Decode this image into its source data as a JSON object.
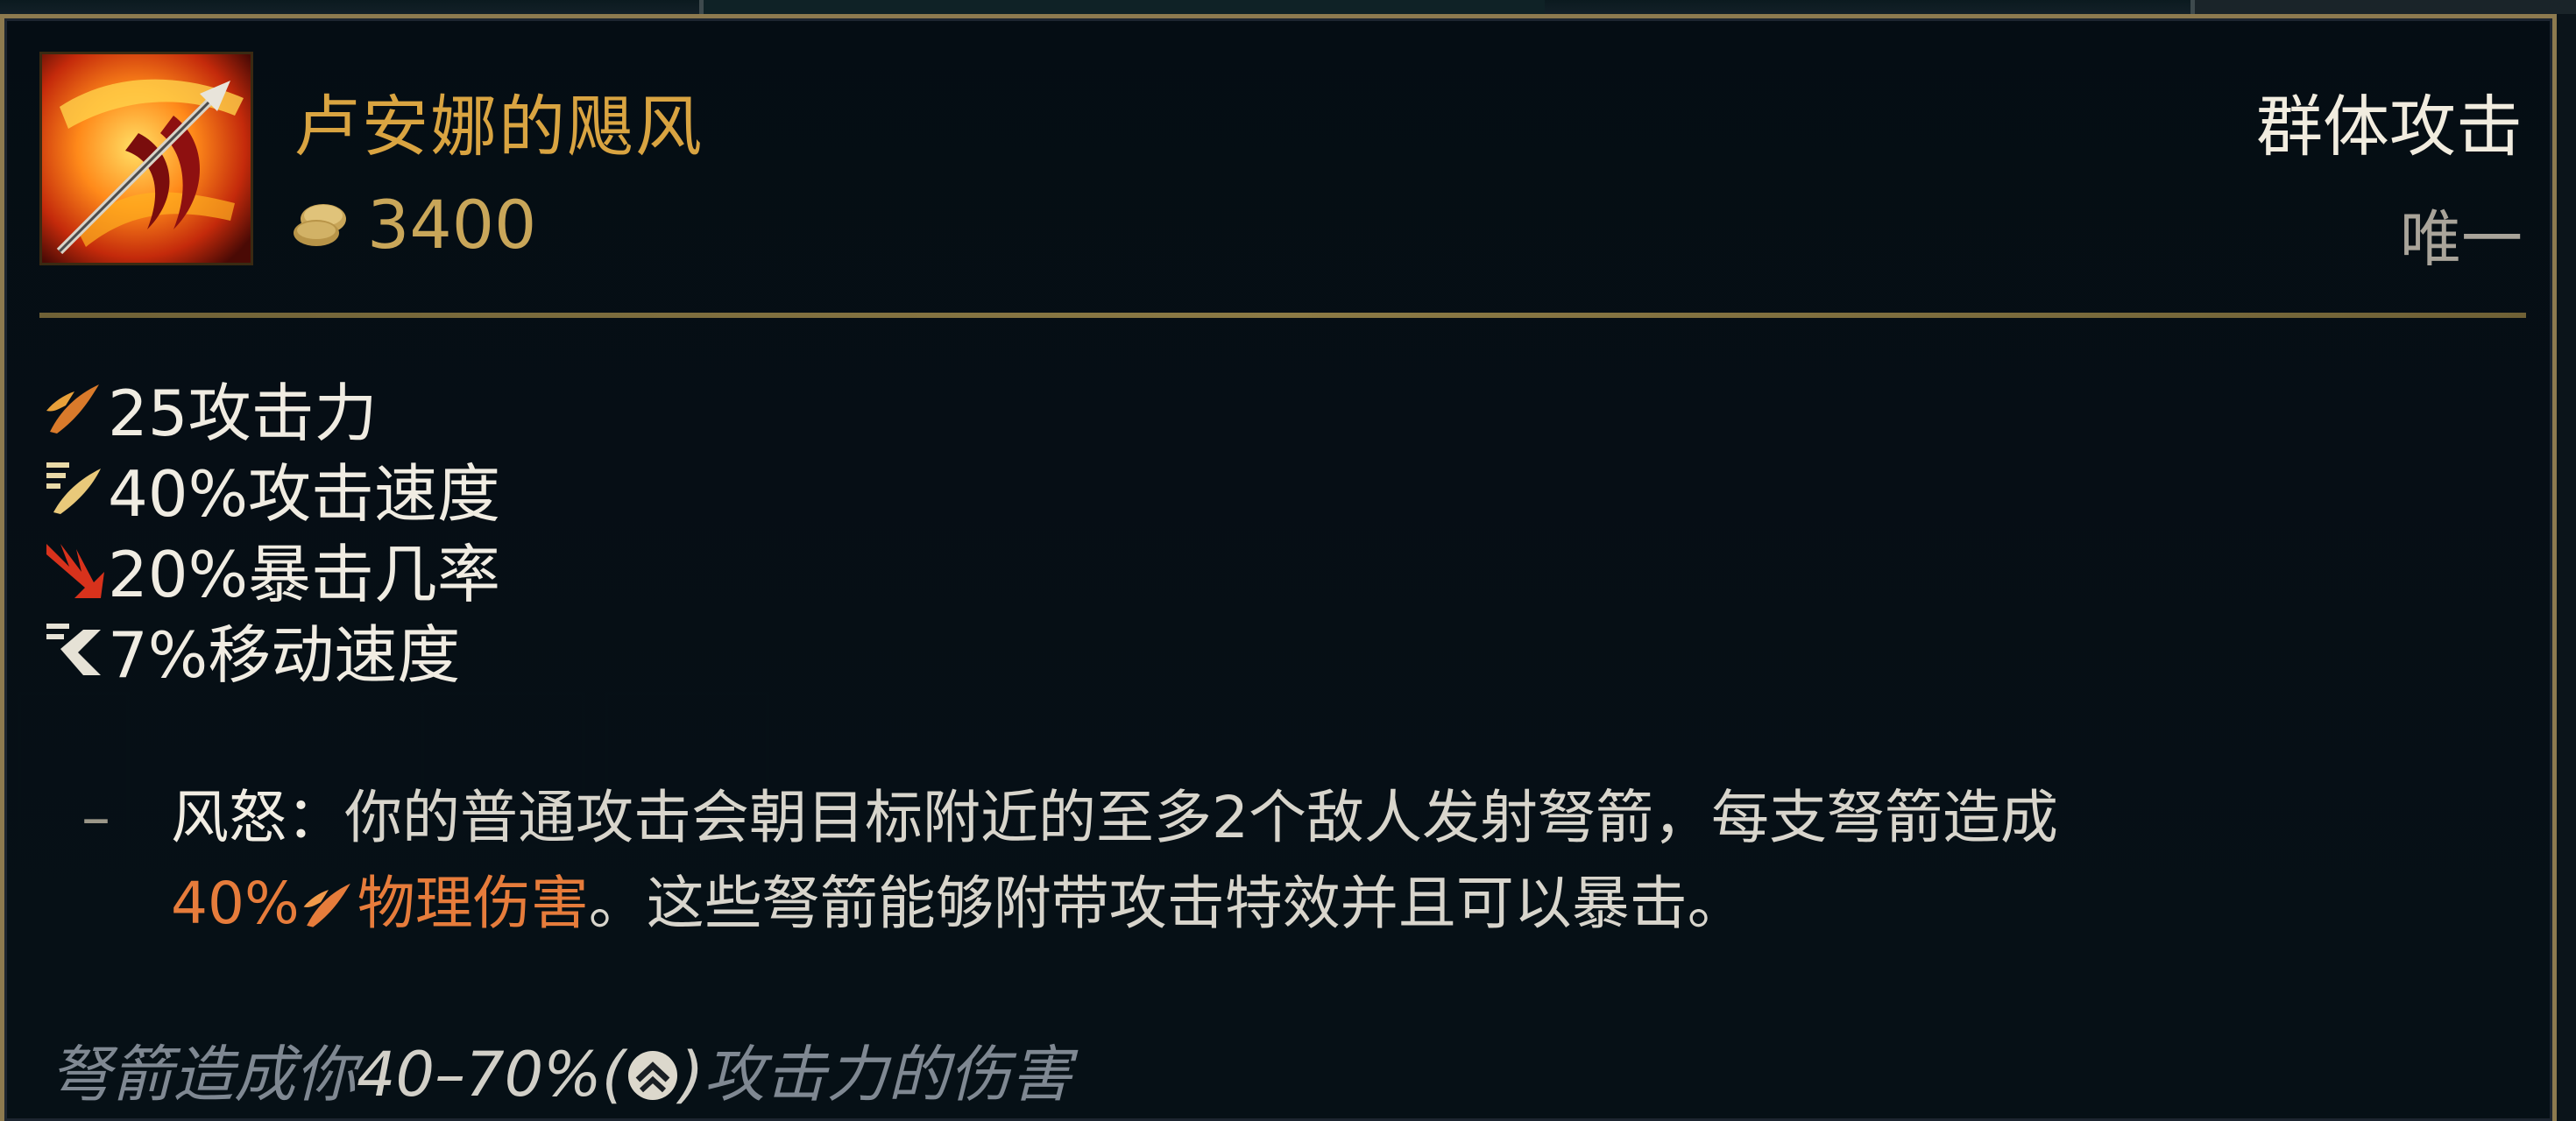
{
  "item": {
    "name": "卢安娜的飓风",
    "cost": "3400",
    "type": "群体攻击",
    "rarity": "唯一",
    "icon": "runaans-hurricane-icon"
  },
  "stats": [
    {
      "icon": "attack-damage-icon",
      "text": "25攻击力"
    },
    {
      "icon": "attack-speed-icon",
      "text": "40%攻击速度"
    },
    {
      "icon": "crit-chance-icon",
      "text": "20%暴击几率"
    },
    {
      "icon": "move-speed-icon",
      "text": "7%移动速度"
    }
  ],
  "passive": {
    "dash": "–",
    "name": "风怒：",
    "text1": "你的普通攻击会朝目标附近的至多2个敌人发射弩箭，每支弩箭造成",
    "percent": "40%",
    "damage_type": "物理伤害",
    "text2": "。这些弩箭能够附带攻击特效并且可以暴击。"
  },
  "flavor": {
    "prefix": "弩箭造成你",
    "range": "40–70%",
    "paren_open": "(",
    "paren_close": ")",
    "suffix": "攻击力的伤害"
  },
  "colors": {
    "gold": "#d9a441",
    "border": "#8d7a4f",
    "physical": "#e67c3b"
  }
}
